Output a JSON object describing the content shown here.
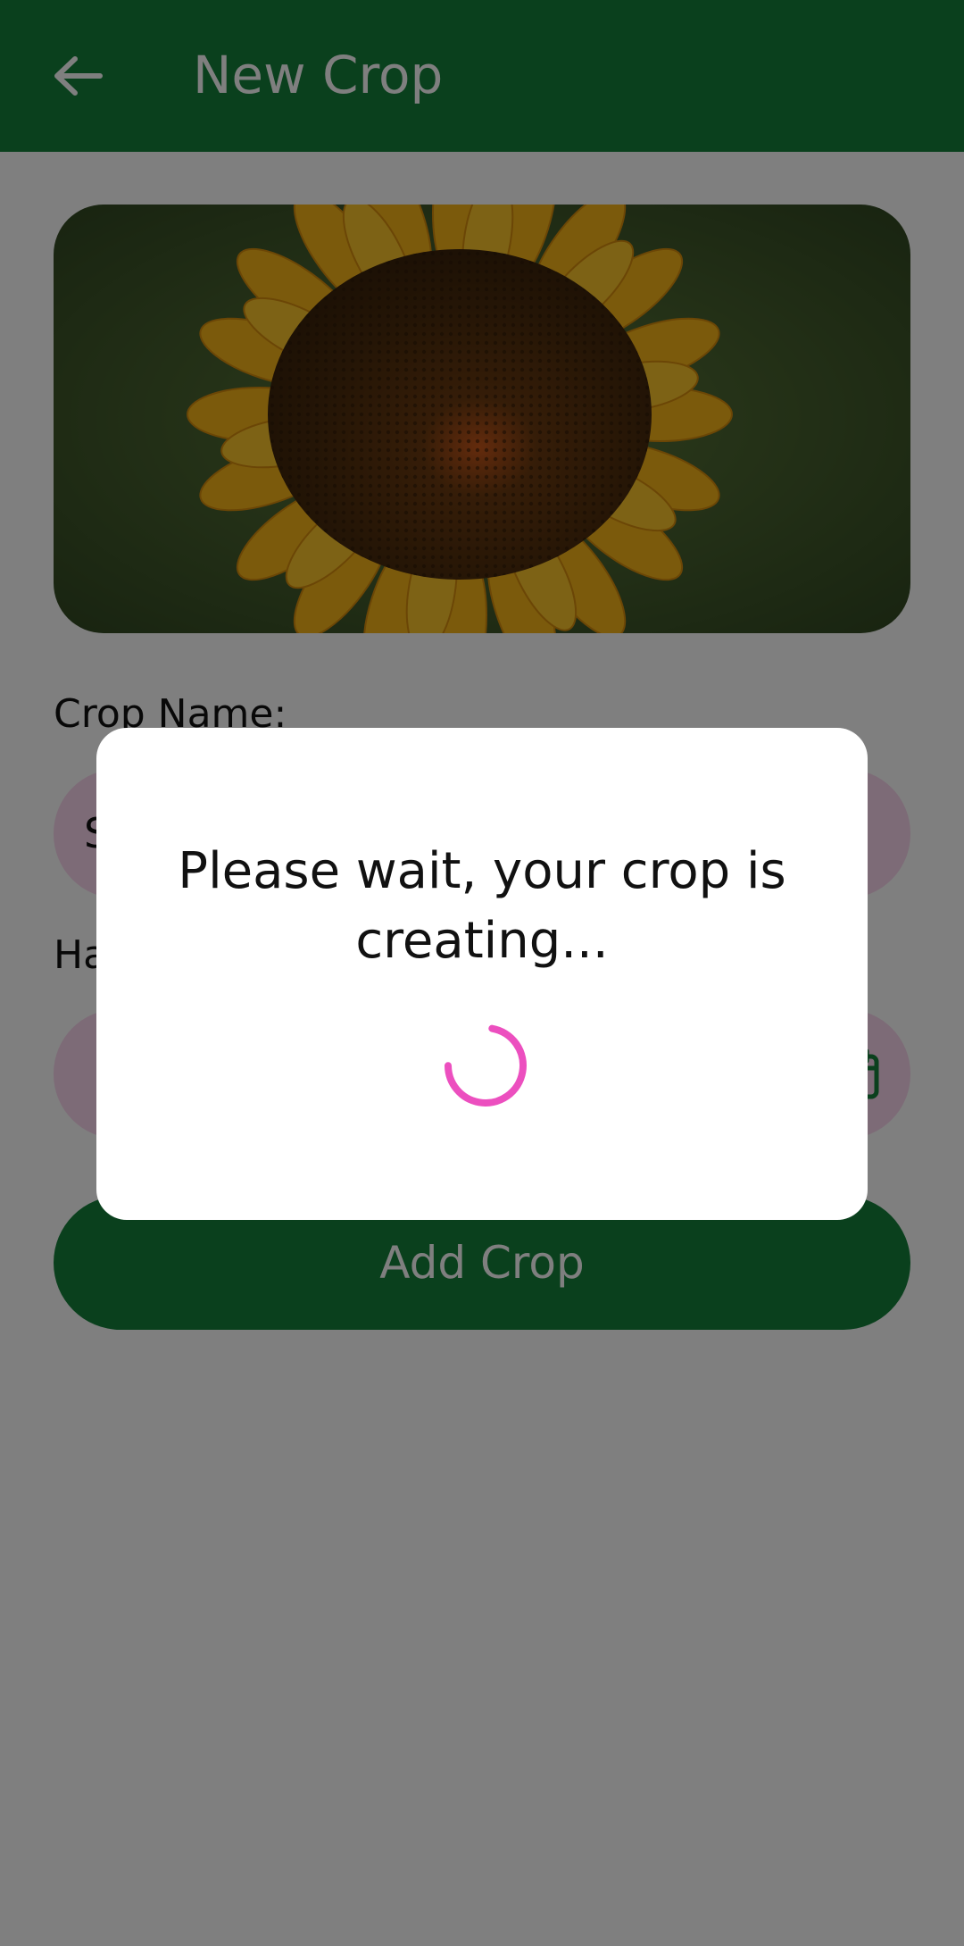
{
  "app_bar": {
    "title": "New Crop",
    "back_icon": "arrow-left-icon",
    "background": "#14803a"
  },
  "hero_image": {
    "subject": "sunflower"
  },
  "form": {
    "crop_name_label": "Crop Name:",
    "crop_name_value": "S",
    "harvest_label": "Ha",
    "harvest_value": "",
    "calendar_icon": "calendar-icon",
    "field_background": "#fad7ee",
    "submit_label": "Add Crop"
  },
  "dialog": {
    "message": "Please wait, your crop is creating...",
    "spinner_color": "#ec4fbf"
  }
}
